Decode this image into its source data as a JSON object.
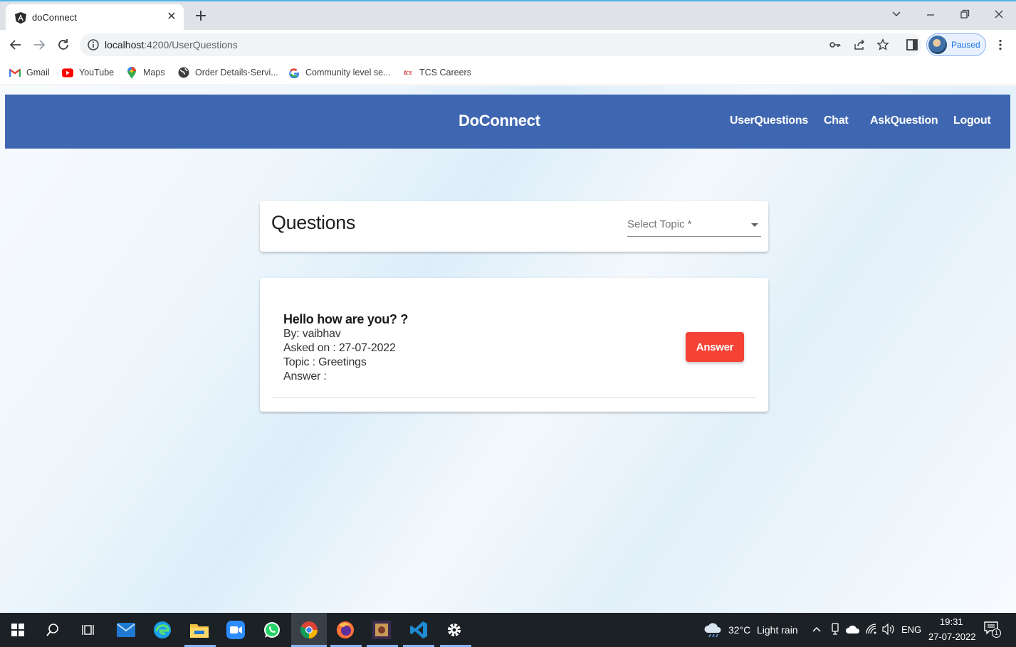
{
  "browser": {
    "tab_title": "doConnect",
    "url_host": "localhost",
    "url_path": ":4200/UserQuestions",
    "profile_label": "Paused",
    "bookmarks": [
      {
        "label": "Gmail",
        "icon": "gmail-icon"
      },
      {
        "label": "YouTube",
        "icon": "youtube-icon"
      },
      {
        "label": "Maps",
        "icon": "maps-icon"
      },
      {
        "label": "Order Details-Servi...",
        "icon": "globe-icon"
      },
      {
        "label": "Community level se...",
        "icon": "google-icon"
      },
      {
        "label": "TCS Careers",
        "icon": "tcs-icon"
      }
    ]
  },
  "app": {
    "brand": "DoConnect",
    "nav": {
      "user_questions": "UserQuestions",
      "chat": "Chat",
      "ask_question": "AskQuestion",
      "logout": "Logout"
    },
    "colors": {
      "navbar": "#3f67b1",
      "answer_button": "#f44336"
    }
  },
  "questions_panel": {
    "title": "Questions",
    "topic_select": {
      "placeholder": "Select Topic *",
      "selected": ""
    }
  },
  "questions": [
    {
      "title": "Hello how are you? ?",
      "by": "By: vaibhav",
      "asked_on": "Asked on : 27-07-2022",
      "topic": "Topic : Greetings",
      "answer": "Answer :",
      "button_label": "Answer"
    }
  ],
  "taskbar": {
    "weather_temp": "32°C",
    "weather_desc": "Light rain",
    "language": "ENG",
    "time": "19:31",
    "date": "27-07-2022",
    "notification_count": "1"
  }
}
